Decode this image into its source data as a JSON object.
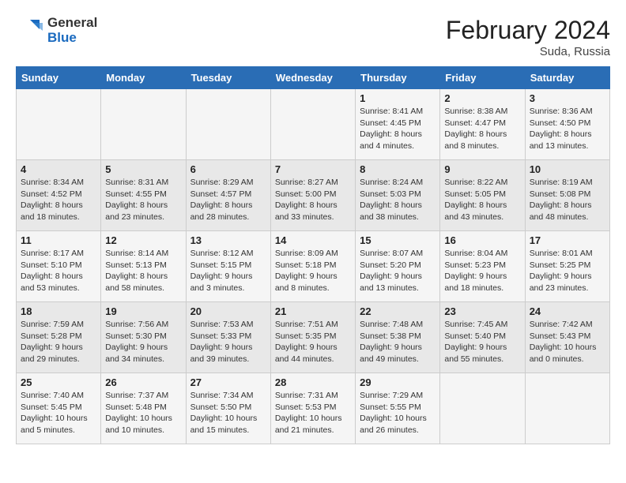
{
  "header": {
    "logo_general": "General",
    "logo_blue": "Blue",
    "month_year": "February 2024",
    "location": "Suda, Russia"
  },
  "weekdays": [
    "Sunday",
    "Monday",
    "Tuesday",
    "Wednesday",
    "Thursday",
    "Friday",
    "Saturday"
  ],
  "weeks": [
    [
      {
        "day": "",
        "info": ""
      },
      {
        "day": "",
        "info": ""
      },
      {
        "day": "",
        "info": ""
      },
      {
        "day": "",
        "info": ""
      },
      {
        "day": "1",
        "info": "Sunrise: 8:41 AM\nSunset: 4:45 PM\nDaylight: 8 hours\nand 4 minutes."
      },
      {
        "day": "2",
        "info": "Sunrise: 8:38 AM\nSunset: 4:47 PM\nDaylight: 8 hours\nand 8 minutes."
      },
      {
        "day": "3",
        "info": "Sunrise: 8:36 AM\nSunset: 4:50 PM\nDaylight: 8 hours\nand 13 minutes."
      }
    ],
    [
      {
        "day": "4",
        "info": "Sunrise: 8:34 AM\nSunset: 4:52 PM\nDaylight: 8 hours\nand 18 minutes."
      },
      {
        "day": "5",
        "info": "Sunrise: 8:31 AM\nSunset: 4:55 PM\nDaylight: 8 hours\nand 23 minutes."
      },
      {
        "day": "6",
        "info": "Sunrise: 8:29 AM\nSunset: 4:57 PM\nDaylight: 8 hours\nand 28 minutes."
      },
      {
        "day": "7",
        "info": "Sunrise: 8:27 AM\nSunset: 5:00 PM\nDaylight: 8 hours\nand 33 minutes."
      },
      {
        "day": "8",
        "info": "Sunrise: 8:24 AM\nSunset: 5:03 PM\nDaylight: 8 hours\nand 38 minutes."
      },
      {
        "day": "9",
        "info": "Sunrise: 8:22 AM\nSunset: 5:05 PM\nDaylight: 8 hours\nand 43 minutes."
      },
      {
        "day": "10",
        "info": "Sunrise: 8:19 AM\nSunset: 5:08 PM\nDaylight: 8 hours\nand 48 minutes."
      }
    ],
    [
      {
        "day": "11",
        "info": "Sunrise: 8:17 AM\nSunset: 5:10 PM\nDaylight: 8 hours\nand 53 minutes."
      },
      {
        "day": "12",
        "info": "Sunrise: 8:14 AM\nSunset: 5:13 PM\nDaylight: 8 hours\nand 58 minutes."
      },
      {
        "day": "13",
        "info": "Sunrise: 8:12 AM\nSunset: 5:15 PM\nDaylight: 9 hours\nand 3 minutes."
      },
      {
        "day": "14",
        "info": "Sunrise: 8:09 AM\nSunset: 5:18 PM\nDaylight: 9 hours\nand 8 minutes."
      },
      {
        "day": "15",
        "info": "Sunrise: 8:07 AM\nSunset: 5:20 PM\nDaylight: 9 hours\nand 13 minutes."
      },
      {
        "day": "16",
        "info": "Sunrise: 8:04 AM\nSunset: 5:23 PM\nDaylight: 9 hours\nand 18 minutes."
      },
      {
        "day": "17",
        "info": "Sunrise: 8:01 AM\nSunset: 5:25 PM\nDaylight: 9 hours\nand 23 minutes."
      }
    ],
    [
      {
        "day": "18",
        "info": "Sunrise: 7:59 AM\nSunset: 5:28 PM\nDaylight: 9 hours\nand 29 minutes."
      },
      {
        "day": "19",
        "info": "Sunrise: 7:56 AM\nSunset: 5:30 PM\nDaylight: 9 hours\nand 34 minutes."
      },
      {
        "day": "20",
        "info": "Sunrise: 7:53 AM\nSunset: 5:33 PM\nDaylight: 9 hours\nand 39 minutes."
      },
      {
        "day": "21",
        "info": "Sunrise: 7:51 AM\nSunset: 5:35 PM\nDaylight: 9 hours\nand 44 minutes."
      },
      {
        "day": "22",
        "info": "Sunrise: 7:48 AM\nSunset: 5:38 PM\nDaylight: 9 hours\nand 49 minutes."
      },
      {
        "day": "23",
        "info": "Sunrise: 7:45 AM\nSunset: 5:40 PM\nDaylight: 9 hours\nand 55 minutes."
      },
      {
        "day": "24",
        "info": "Sunrise: 7:42 AM\nSunset: 5:43 PM\nDaylight: 10 hours\nand 0 minutes."
      }
    ],
    [
      {
        "day": "25",
        "info": "Sunrise: 7:40 AM\nSunset: 5:45 PM\nDaylight: 10 hours\nand 5 minutes."
      },
      {
        "day": "26",
        "info": "Sunrise: 7:37 AM\nSunset: 5:48 PM\nDaylight: 10 hours\nand 10 minutes."
      },
      {
        "day": "27",
        "info": "Sunrise: 7:34 AM\nSunset: 5:50 PM\nDaylight: 10 hours\nand 15 minutes."
      },
      {
        "day": "28",
        "info": "Sunrise: 7:31 AM\nSunset: 5:53 PM\nDaylight: 10 hours\nand 21 minutes."
      },
      {
        "day": "29",
        "info": "Sunrise: 7:29 AM\nSunset: 5:55 PM\nDaylight: 10 hours\nand 26 minutes."
      },
      {
        "day": "",
        "info": ""
      },
      {
        "day": "",
        "info": ""
      }
    ]
  ]
}
